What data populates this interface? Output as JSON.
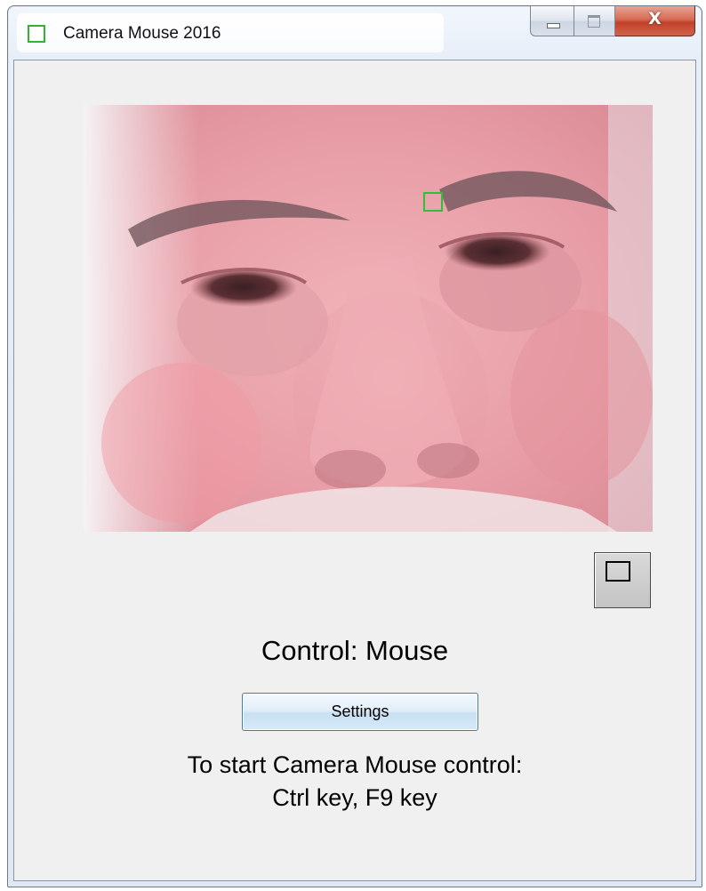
{
  "window": {
    "title": "Camera Mouse 2016",
    "app_icon": "green-square-icon",
    "caption_buttons": {
      "minimize_icon": "minimize-icon",
      "maximize_icon": "maximize-icon",
      "close_glyph": "X"
    }
  },
  "camera": {
    "tracking_marker_color": "#2fbf3a"
  },
  "toggle": {
    "icon": "square-outline-icon"
  },
  "status": {
    "control_label": "Control: Mouse"
  },
  "settings": {
    "label": "Settings"
  },
  "instructions": {
    "line1": "To start Camera Mouse control:",
    "line2": "Ctrl key, F9 key"
  },
  "colors": {
    "settings_border": "#3c7fb1",
    "close_button": "#c2412a",
    "client_background": "#f0f0f0"
  }
}
